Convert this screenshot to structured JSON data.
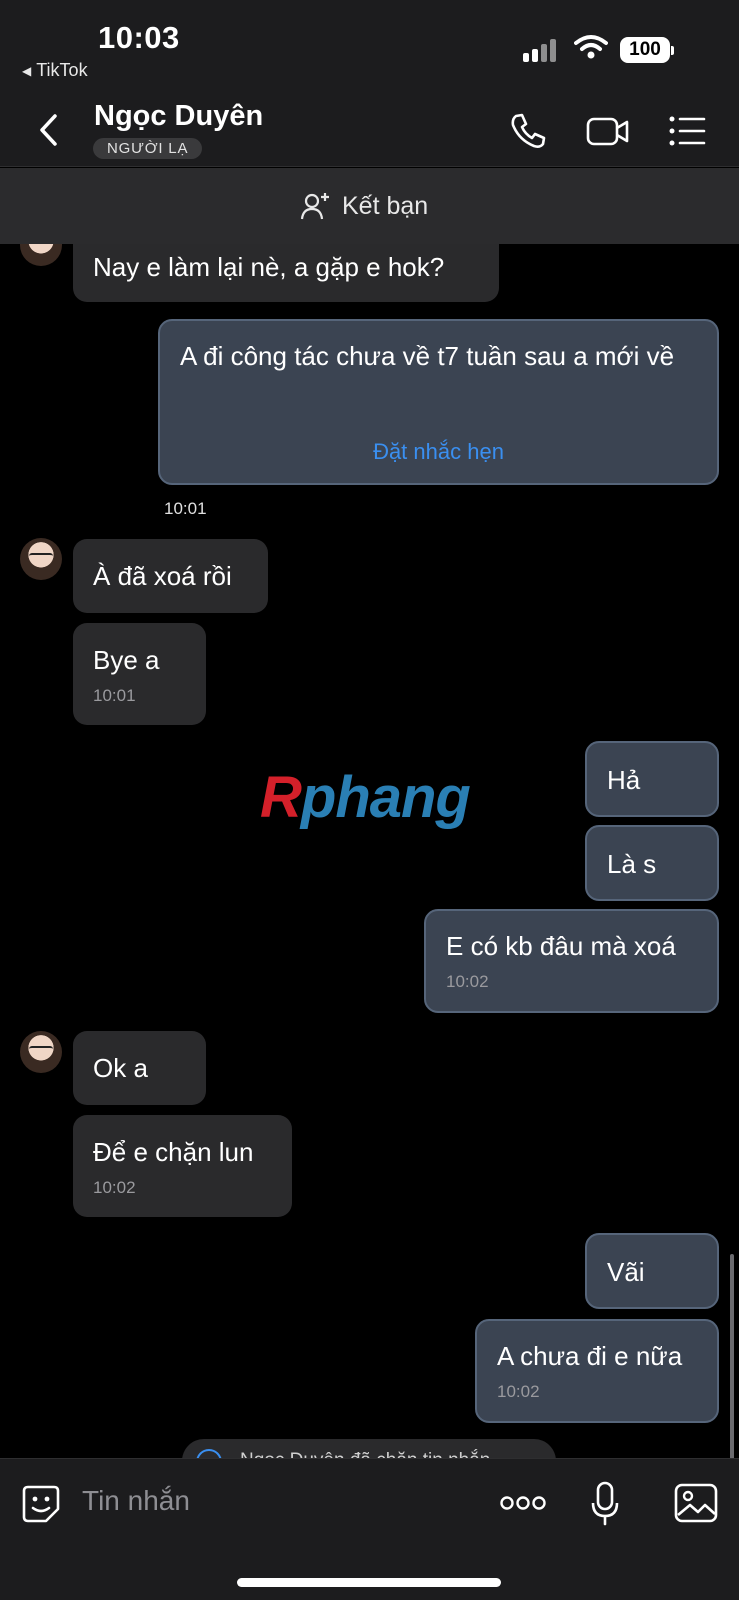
{
  "status_bar": {
    "time": "10:03",
    "back_app": "TikTok",
    "battery": "100"
  },
  "header": {
    "contact_name": "Ngọc Duyên",
    "badge": "NGƯỜI LẠ"
  },
  "friend_bar": {
    "label": "Kết bạn"
  },
  "messages": [
    {
      "side": "in",
      "text": "Nay e làm lại nè, a gặp e hok?"
    },
    {
      "side": "out",
      "text": "A đi công tác chưa về t7 tuần sau a mới về",
      "action": "Đặt nhắc hẹn",
      "time": "10:01"
    },
    {
      "side": "in",
      "text": "À đã xoá rồi"
    },
    {
      "side": "in",
      "text": "Bye a",
      "time": "10:01"
    },
    {
      "side": "out",
      "text": "Hả"
    },
    {
      "side": "out",
      "text": "Là s"
    },
    {
      "side": "out",
      "text": "E có kb đâu mà xoá",
      "time": "10:02"
    },
    {
      "side": "in",
      "text": "Ok a"
    },
    {
      "side": "in",
      "text": "Để e chặn lun",
      "time": "10:02"
    },
    {
      "side": "out",
      "text": "Vãi"
    },
    {
      "side": "out",
      "text": "A chưa đi e nữa",
      "time": "10:02"
    }
  ],
  "watermark": {
    "first": "R",
    "rest": "phang"
  },
  "system_notice": "Ngọc Duyên đã chặn tin nhắn",
  "input": {
    "placeholder": "Tin nhắn"
  },
  "icons": {
    "back": "chevron-left-icon",
    "call": "phone-icon",
    "video": "video-camera-icon",
    "menu": "list-menu-icon",
    "add_friend": "add-user-icon",
    "sticker": "sticker-face-icon",
    "more": "more-dots-icon",
    "voice": "microphone-icon",
    "photo": "image-icon"
  },
  "colors": {
    "incoming_bubble": "#2a2a2c",
    "outgoing_bubble": "#3b4452",
    "link": "#3a8ff0"
  }
}
